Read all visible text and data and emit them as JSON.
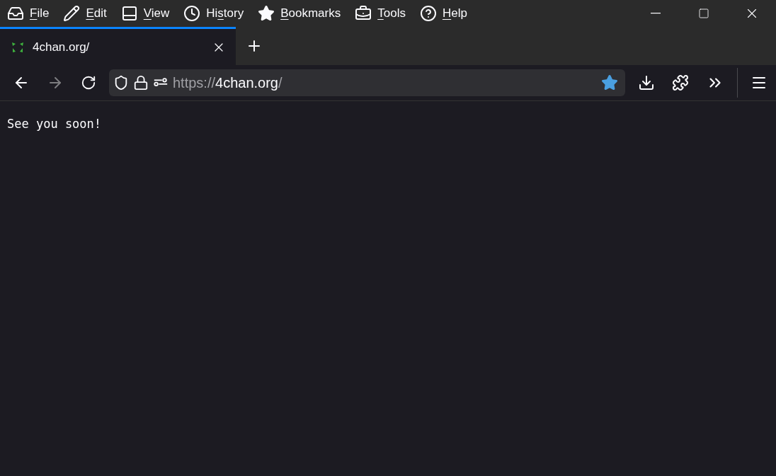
{
  "menu_bar": {
    "items": [
      {
        "kind": "file",
        "key": "F",
        "after": "ile"
      },
      {
        "kind": "edit",
        "key": "E",
        "after": "dit"
      },
      {
        "kind": "view",
        "key": "V",
        "after": "iew"
      },
      {
        "kind": "history",
        "before": "Hi",
        "key": "s",
        "after": "tory"
      },
      {
        "kind": "bookmarks",
        "key": "B",
        "after": "ookmarks"
      },
      {
        "kind": "tools",
        "key": "T",
        "after": "ools"
      },
      {
        "kind": "help",
        "key": "H",
        "after": "elp"
      }
    ]
  },
  "tabs": [
    {
      "title": "4chan.org/",
      "selected": true
    }
  ],
  "nav": {
    "back_disabled": false,
    "forward_disabled": true,
    "url": {
      "scheme": "https://",
      "host": "4chan.org",
      "path": "/"
    },
    "bookmarked": true
  },
  "page": {
    "text": "See you soon!"
  }
}
